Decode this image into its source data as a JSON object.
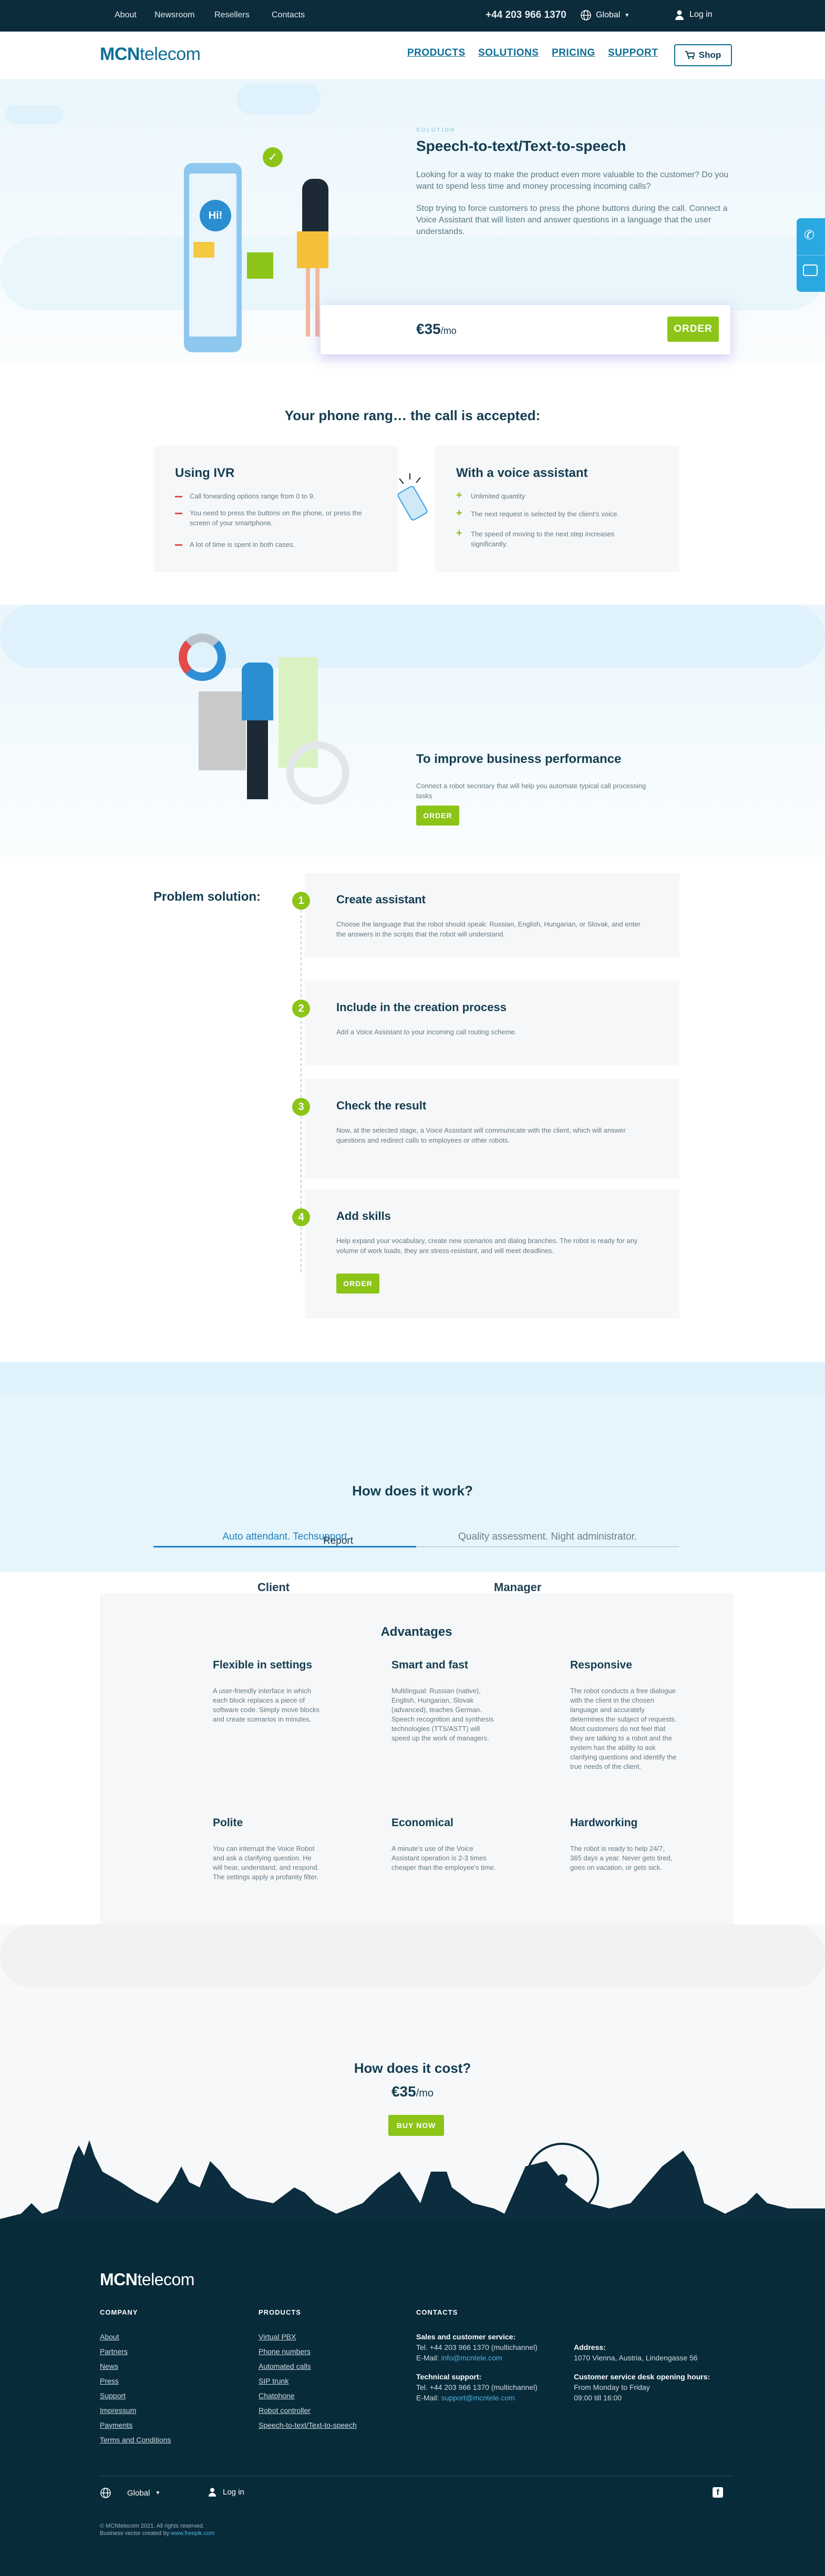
{
  "topbar": {
    "about": "About",
    "newsroom": "Newsroom",
    "resellers": "Resellers",
    "contacts": "Contacts",
    "phone": "+44 203 966 1370",
    "region": "Global",
    "login": "Log in"
  },
  "header": {
    "logo_bold": "MCN",
    "logo_light": "telecom",
    "nav": [
      "PRODUCTS",
      "SOLUTIONS",
      "PRICING",
      "SUPPORT"
    ],
    "shop": "Shop"
  },
  "hero": {
    "eyebrow": "SOLUTION",
    "title": "Speech-to-text/Text-to-speech",
    "p1": "Looking for a way to make the product even more valuable to the customer? Do you want to spend less time and money processing incoming calls?",
    "p2": "Stop trying to force customers to press the phone buttons during the call. Connect a Voice Assistant that will listen and answer questions in a language that the user understands.",
    "phone_badge": "Hi!",
    "price": "€35",
    "per": "/mo",
    "order": "ORDER"
  },
  "compare": {
    "title": "Your phone rang… the call is accepted:",
    "ivr": {
      "title": "Using IVR",
      "items": [
        "Call forwarding options range from 0 to 9.",
        "You need to press the buttons on the phone, or press the screen of your smartphone.",
        "A lot of time is spent in both cases."
      ]
    },
    "va": {
      "title": "With a voice assistant",
      "items": [
        "Unlimited quantity",
        "The next request is selected by the client's voice.",
        "The speed of moving to the next step increases significantly."
      ]
    }
  },
  "improve": {
    "title": "To improve business performance",
    "text": "Connect a robot secretary that will help you automate typical call processing tasks",
    "btn": "ORDER"
  },
  "problem": {
    "label": "Problem solution:",
    "steps": [
      {
        "n": "1",
        "title": "Create assistant",
        "text": "Choose the language that the robot should speak: Russian, English, Hungarian, or Slovak, and enter the answers in the scripts that the robot will understand."
      },
      {
        "n": "2",
        "title": "Include in the creation process",
        "text": "Add a Voice Assistant to your incoming call routing scheme."
      },
      {
        "n": "3",
        "title": "Check the result",
        "text": "Now, at the selected stage, a Voice Assistant will communicate with the client, which will answer questions and redirect calls to employees or other robots."
      },
      {
        "n": "4",
        "title": "Add skills",
        "text": "Help expand your vocabulary, create new scenarios and dialog branches. The robot is ready for any volume of work loads, they are stress-resistant, and will meet deadlines."
      }
    ],
    "btn": "ORDER"
  },
  "how": {
    "title": "How does it work?",
    "tab1": "Auto attendant. Techsupport",
    "tab2": "Quality assessment. Night administrator.",
    "report": "Report",
    "client": "Client",
    "manager": "Manager"
  },
  "advantages": {
    "title": "Advantages",
    "items": [
      {
        "t": "Flexible in settings",
        "d": "A user-friendly interface in which each block replaces a piece of software code. Simply move blocks and create scenarios in minutes."
      },
      {
        "t": "Smart and fast",
        "d": "Multilingual: Russian (native), English, Hungarian, Slovak (advanced), teaches German. Speech recognition and synthesis technologies (TTS/ASTT) will speed up the work of managers."
      },
      {
        "t": "Responsive",
        "d": "The robot conducts a free dialogue with the client in the chosen language and accurately determines the subject of requests. Most customers do not feel that they are talking to a robot and the system has the ability to ask clarifying questions and identify the true needs of the client."
      },
      {
        "t": "Polite",
        "d": "You can interrupt the Voice Robot and ask a clarifying question. He will hear, understand, and respond. The settings apply a profanity filter."
      },
      {
        "t": "Economical",
        "d": "A minute's use of the Voice Assistant operation is 2-3 times cheaper than the employee's time."
      },
      {
        "t": "Hardworking",
        "d": "The robot is ready to help 24/7, 365 days a year. Never gets tired, goes on vacation, or gets sick."
      }
    ]
  },
  "cost": {
    "title": "How does it cost?",
    "price": "€35",
    "per": "/mo",
    "btn": "BUY NOW"
  },
  "footer": {
    "logo_bold": "MCN",
    "logo_light": "telecom",
    "company": "COMPANY",
    "company_links": [
      "About",
      "Partners",
      "News",
      "Press",
      "Support",
      "Impressum",
      "Payments",
      "Terms and Conditions"
    ],
    "products": "PRODUCTS",
    "product_links": [
      "Virtual PBX",
      "Phone numbers",
      "Automated calls",
      "SIP trunk",
      "Chatphone",
      "Robot controller",
      "Speech-to-text/Text-to-speech"
    ],
    "contacts": "CONTACTS",
    "sales_h": "Sales and customer service:",
    "sales_tel": "Tel. +44 203 966 1370 (multichannel)",
    "sales_mail_l": "E-Mail: ",
    "sales_mail": "info@mcntele.com",
    "tech_h": "Technical support:",
    "tech_tel": "Tel. +44 203 966 1370 (multichannel)",
    "tech_mail_l": "E-Mail: ",
    "tech_mail": "support@mcntele.com",
    "addr_h": "Address:",
    "addr": "1070 Vienna, Austria, Lindengasse 56",
    "hours_h": "Customer service desk opening hours:",
    "hours1": "From Monday to Friday",
    "hours2": "09:00 till 16:00",
    "region": "Global",
    "login": "Log in",
    "copy": "© MCNtelecom 2021. All rights reserved.",
    "credit_l": "Business vector created by ",
    "credit": "www.freepik.com"
  },
  "colors": {
    "brand": "#0d6e97",
    "accent": "#8cc418",
    "dark": "#082b3a",
    "alert": "#e34b4b"
  }
}
